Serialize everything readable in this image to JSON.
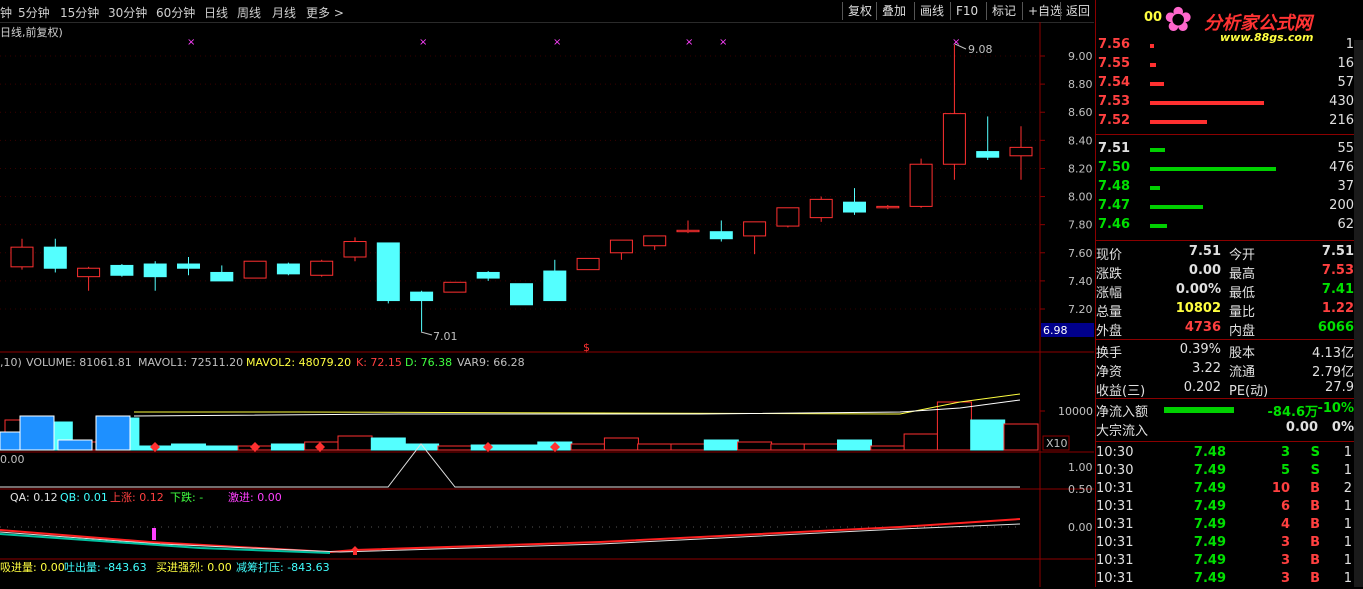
{
  "toolbar": {
    "periods": [
      "钟",
      "5分钟",
      "15分钟",
      "30分钟",
      "60分钟",
      "日线",
      "周线",
      "月线",
      "更多 >"
    ],
    "buttons": [
      "复权",
      "叠加",
      "画线",
      "F10",
      "标记",
      "+自选",
      "返回"
    ]
  },
  "chart_title": "日线,前复权)",
  "price_axis": [
    "9.00",
    "8.80",
    "8.60",
    "8.40",
    "8.20",
    "8.00",
    "7.80",
    "7.60",
    "7.40",
    "7.20"
  ],
  "price_marker": "6.98",
  "annotations": {
    "high": "9.08",
    "low": "7.01"
  },
  "volume_legend": {
    "prefix": ",10)",
    "volume": "VOLUME: 81061.81",
    "mavol1": "MAVOL1: 72511.20",
    "mavol2": "MAVOL2: 48079.20",
    "k": "K: 72.15",
    "d": "D: 76.38",
    "var9": "VAR9: 66.28"
  },
  "volume_axis": {
    "label": "10000",
    "unit": "X10"
  },
  "osc_axis": [
    "1.00",
    "0.50"
  ],
  "qa_legend": {
    "qa": "QA: 0.12",
    "qb": "QB: 0.01",
    "up": "上涨: 0.12",
    "down": "下跌: -",
    "jj": "激进: 0.00"
  },
  "qa_axis": "0.00",
  "bottom_legend": {
    "a": "吸进量: 0.00",
    "b": "吐出量: -843.63",
    "c": "买进强烈: 0.00",
    "d": "减筹打压: -843.63"
  },
  "osc_prefix": "0.00",
  "chart_data": {
    "type": "candlestick",
    "series": [
      {
        "values": [
          [
            7.5,
            7.64,
            7.48,
            7.7
          ]
        ]
      }
    ],
    "candles": [
      [
        7.5,
        7.64,
        7.48,
        7.7
      ],
      [
        7.64,
        7.49,
        7.46,
        7.7
      ],
      [
        7.43,
        7.49,
        7.33,
        7.5
      ],
      [
        7.51,
        7.44,
        7.43,
        7.52
      ],
      [
        7.52,
        7.43,
        7.33,
        7.54
      ],
      [
        7.52,
        7.49,
        7.44,
        7.57
      ],
      [
        7.46,
        7.4,
        7.4,
        7.51
      ],
      [
        7.42,
        7.54,
        7.42,
        7.54
      ],
      [
        7.52,
        7.45,
        7.44,
        7.53
      ],
      [
        7.44,
        7.54,
        7.43,
        7.55
      ],
      [
        7.57,
        7.68,
        7.54,
        7.71
      ],
      [
        7.67,
        7.26,
        7.24,
        7.67
      ],
      [
        7.32,
        7.26,
        7.04,
        7.33
      ],
      [
        7.32,
        7.39,
        7.32,
        7.39
      ],
      [
        7.46,
        7.42,
        7.4,
        7.47
      ],
      [
        7.38,
        7.23,
        7.23,
        7.38
      ],
      [
        7.47,
        7.26,
        7.26,
        7.55
      ],
      [
        7.48,
        7.56,
        7.48,
        7.56
      ],
      [
        7.6,
        7.69,
        7.55,
        7.69
      ],
      [
        7.65,
        7.72,
        7.62,
        7.72
      ],
      [
        7.75,
        7.76,
        7.74,
        7.83
      ],
      [
        7.75,
        7.7,
        7.68,
        7.83
      ],
      [
        7.72,
        7.82,
        7.59,
        7.82
      ],
      [
        7.79,
        7.92,
        7.78,
        7.92
      ],
      [
        7.85,
        7.98,
        7.82,
        8.0
      ],
      [
        7.96,
        7.89,
        7.87,
        8.06
      ],
      [
        7.92,
        7.93,
        7.91,
        7.94
      ],
      [
        7.93,
        8.23,
        7.92,
        8.27
      ],
      [
        8.23,
        8.59,
        8.12,
        9.08
      ],
      [
        8.32,
        8.28,
        8.26,
        8.57
      ],
      [
        8.29,
        8.35,
        8.12,
        8.5
      ]
    ]
  },
  "orderbook": {
    "asks": [
      {
        "price": "7.56",
        "vol": "1",
        "w": 4
      },
      {
        "price": "7.55",
        "vol": "16",
        "w": 6
      },
      {
        "price": "7.54",
        "vol": "57",
        "w": 14
      },
      {
        "price": "7.53",
        "vol": "430",
        "w": 114
      },
      {
        "price": "7.52",
        "vol": "216",
        "w": 57
      }
    ],
    "bids": [
      {
        "price": "7.51",
        "vol": "55",
        "w": 15
      },
      {
        "price": "7.50",
        "vol": "476",
        "w": 126
      },
      {
        "price": "7.48",
        "vol": "37",
        "w": 10
      },
      {
        "price": "7.47",
        "vol": "200",
        "w": 53
      },
      {
        "price": "7.46",
        "vol": "62",
        "w": 17
      }
    ]
  },
  "quote": [
    {
      "l": "现价",
      "v": "7.51",
      "vc": "white",
      "l2": "今开",
      "v2": "7.51",
      "v2c": "white"
    },
    {
      "l": "涨跌",
      "v": "0.00",
      "vc": "white",
      "l2": "最高",
      "v2": "7.53",
      "v2c": "red"
    },
    {
      "l": "涨幅",
      "v": "0.00%",
      "vc": "white",
      "l2": "最低",
      "v2": "7.41",
      "v2c": "green"
    },
    {
      "l": "总量",
      "v": "10802",
      "vc": "yellow",
      "l2": "量比",
      "v2": "1.22",
      "v2c": "red"
    },
    {
      "l": "外盘",
      "v": "4736",
      "vc": "red",
      "l2": "内盘",
      "v2": "6066",
      "v2c": "green"
    }
  ],
  "quote2": [
    {
      "l": "换手",
      "v": "0.39%",
      "l2": "股本",
      "v2": "4.13亿"
    },
    {
      "l": "净资",
      "v": "3.22",
      "l2": "流通",
      "v2": "2.79亿"
    },
    {
      "l": "收益(三)",
      "v": "0.202",
      "l2": "PE(动)",
      "v2": "27.9"
    }
  ],
  "flows": {
    "net_label": "净流入额",
    "net_val": "-84.6万",
    "net_pct": "-10%",
    "big_label": "大宗流入",
    "big_val": "0.00",
    "big_pct": "0%"
  },
  "ticks": [
    {
      "t": "10:30",
      "p": "7.48",
      "v": "3",
      "s": "S",
      "n": "1"
    },
    {
      "t": "10:30",
      "p": "7.49",
      "v": "5",
      "s": "S",
      "n": "1"
    },
    {
      "t": "10:31",
      "p": "7.49",
      "v": "10",
      "s": "B",
      "n": "2"
    },
    {
      "t": "10:31",
      "p": "7.49",
      "v": "6",
      "s": "B",
      "n": "1"
    },
    {
      "t": "10:31",
      "p": "7.49",
      "v": "4",
      "s": "B",
      "n": "1"
    },
    {
      "t": "10:31",
      "p": "7.49",
      "v": "3",
      "s": "B",
      "n": "1"
    },
    {
      "t": "10:31",
      "p": "7.49",
      "v": "3",
      "s": "B",
      "n": "1"
    },
    {
      "t": "10:31",
      "p": "7.49",
      "v": "3",
      "s": "B",
      "n": "1"
    }
  ],
  "logo": {
    "brand": "分析家公式网",
    "url": "www.88gs.com",
    "code": "00"
  }
}
